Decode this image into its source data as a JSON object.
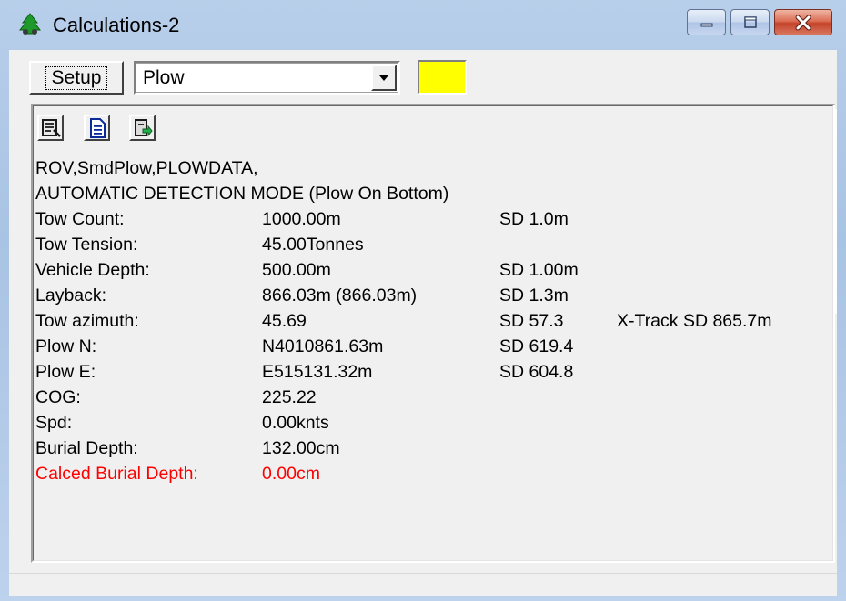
{
  "window": {
    "title": "Calculations-2",
    "icon": "app-plow-icon"
  },
  "toolbar": {
    "setup_label": "Setup",
    "selected_vehicle": "Plow",
    "swatch_color": "#ffff00"
  },
  "icons": [
    "report-icon",
    "document-icon",
    "export-icon"
  ],
  "header_lines": [
    "ROV,SmdPlow,PLOWDATA,",
    "AUTOMATIC DETECTION MODE (Plow On Bottom)"
  ],
  "rows": [
    {
      "label": "Tow Count:",
      "value": "1000.00m",
      "sd": "SD 1.0m",
      "extra": ""
    },
    {
      "label": "Tow Tension:",
      "value": "45.00Tonnes",
      "sd": "",
      "extra": ""
    },
    {
      "label": "Vehicle Depth:",
      "value": "500.00m",
      "sd": "SD 1.00m",
      "extra": ""
    },
    {
      "label": "Layback:",
      "value": "866.03m (866.03m)",
      "sd": "SD 1.3m",
      "extra": ""
    },
    {
      "label": "Tow azimuth:",
      "value": "45.69",
      "sd": "SD 57.3",
      "extra": "X-Track SD 865.7m"
    },
    {
      "label": "Plow N:",
      "value": "N4010861.63m",
      "sd": "SD 619.4",
      "extra": ""
    },
    {
      "label": "Plow E:",
      "value": "E515131.32m",
      "sd": "SD 604.8",
      "extra": ""
    },
    {
      "label": "COG:",
      "value": "225.22",
      "sd": "",
      "extra": ""
    },
    {
      "label": "Spd:",
      "value": "0.00knts",
      "sd": "",
      "extra": ""
    },
    {
      "label": "Burial Depth:",
      "value": "132.00cm",
      "sd": "",
      "extra": ""
    },
    {
      "label": "Calced Burial Depth:",
      "value": "0.00cm",
      "sd": "",
      "extra": ""
    }
  ],
  "colors": {
    "warning_text": "#ff0000",
    "window_bg": "#f0f0f0"
  }
}
